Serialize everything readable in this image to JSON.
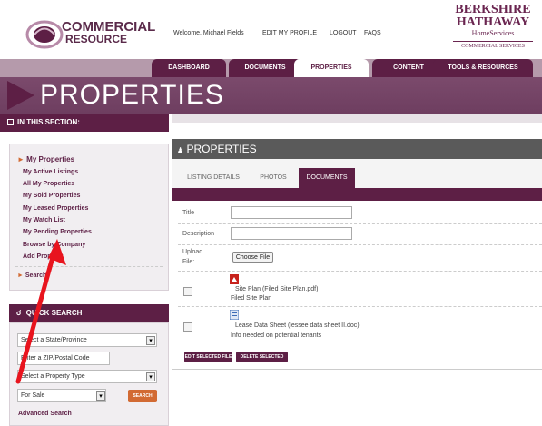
{
  "header": {
    "logo_line1": "COMMERCIAL",
    "logo_line2": "RESOURCE",
    "welcome": "Welcome, Michael Fields",
    "edit_profile": "EDIT MY PROFILE",
    "logout": "LOGOUT",
    "faqs": "FAQS",
    "brand_line1": "BERKSHIRE",
    "brand_line2": "HATHAWAY",
    "brand_line3": "HomeServices",
    "brand_line4": "COMMERCIAL SERVICES"
  },
  "nav": {
    "tabs": [
      "DASHBOARD",
      "DOCUMENTS",
      "PROPERTIES",
      "CONTENT",
      "TOOLS & RESOURCES"
    ],
    "active_index": 2
  },
  "left": {
    "page_title": "PROPERTIES",
    "section_header": "IN THIS SECTION:",
    "links": [
      "My Properties",
      "My Active Listings",
      "All My Properties",
      "My Sold Properties",
      "My Leased Properties",
      "My Watch List",
      "My Pending Properties",
      "Browse by Company",
      "Add Property"
    ],
    "search_link": "Search",
    "quick_search": {
      "title": "QUICK SEARCH",
      "state_select": "Select a State/Province",
      "zip_placeholder": "Enter a ZIP/Postal Code",
      "type_select": "Select a Property Type",
      "sale_select": "For Sale",
      "search_button": "SEARCH",
      "advanced": "Advanced Search"
    }
  },
  "panel": {
    "title": "PROPERTIES",
    "tabs": [
      "LISTING DETAILS",
      "PHOTOS",
      "DOCUMENTS"
    ],
    "active_tab": 2,
    "form": {
      "title_label": "Title",
      "description_label": "Description",
      "upload_label_1": "Upload",
      "upload_label_2": "File:",
      "choose_file": "Choose File"
    },
    "files": [
      {
        "name": "Site Plan (Filed Site Plan.pdf)",
        "description": "Filed Site Plan",
        "type": "pdf-icon"
      },
      {
        "name": "Lease Data Sheet (lessee data sheet II.doc)",
        "description": "Info needed on potential tenants",
        "type": "doc-icon"
      }
    ],
    "edit_button": "EDIT SELECTED FILE",
    "delete_button": "DELETE SELECTED FILES"
  },
  "colors": {
    "brand": "#5d1f45",
    "orange": "#d26a33",
    "annotation_arrow": "#e8141e"
  }
}
